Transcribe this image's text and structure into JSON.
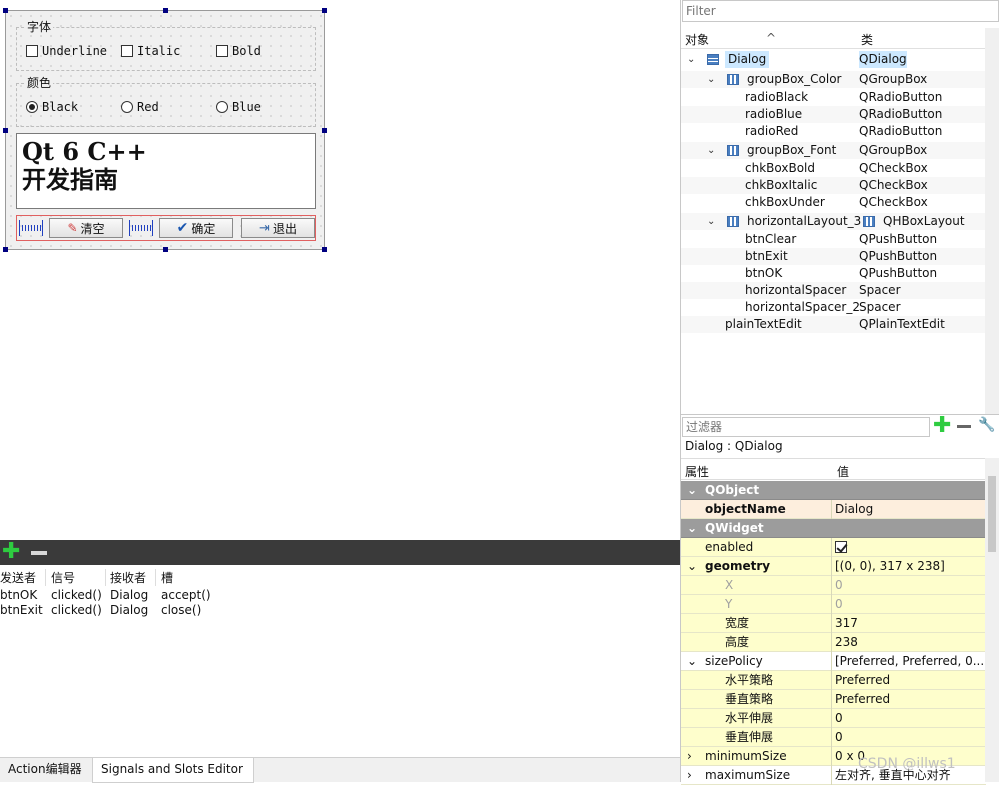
{
  "form": {
    "font_group_title": "字体",
    "checkboxes": [
      {
        "label": "Underline",
        "checked": false
      },
      {
        "label": "Italic",
        "checked": false
      },
      {
        "label": "Bold",
        "checked": false
      }
    ],
    "color_group_title": "颜色",
    "radios": [
      {
        "label": "Black",
        "checked": true
      },
      {
        "label": "Red",
        "checked": false
      },
      {
        "label": "Blue",
        "checked": false
      }
    ],
    "plain_text": "Qt 6 C++\n开发指南",
    "buttons": {
      "clear": "清空",
      "ok": "确定",
      "exit": "退出"
    }
  },
  "signals": {
    "headers": [
      "发送者",
      "信号",
      "接收者",
      "槽"
    ],
    "rows": [
      [
        "btnOK",
        "clicked()",
        "Dialog",
        "accept()"
      ],
      [
        "btnExit",
        "clicked()",
        "Dialog",
        "close()"
      ]
    ]
  },
  "bottom_tabs": [
    "Action编辑器",
    "Signals and Slots Editor"
  ],
  "object_inspector": {
    "filter_placeholder": "Filter",
    "col_object": "对象",
    "col_class": "类",
    "tree": [
      {
        "name": "Dialog",
        "class": "QDialog"
      },
      {
        "name": "groupBox_Color",
        "class": "QGroupBox"
      },
      {
        "name": "radioBlack",
        "class": "QRadioButton"
      },
      {
        "name": "radioBlue",
        "class": "QRadioButton"
      },
      {
        "name": "radioRed",
        "class": "QRadioButton"
      },
      {
        "name": "groupBox_Font",
        "class": "QGroupBox"
      },
      {
        "name": "chkBoxBold",
        "class": "QCheckBox"
      },
      {
        "name": "chkBoxItalic",
        "class": "QCheckBox"
      },
      {
        "name": "chkBoxUnder",
        "class": "QCheckBox"
      },
      {
        "name": "horizontalLayout_3",
        "class": "QHBoxLayout"
      },
      {
        "name": "btnClear",
        "class": "QPushButton"
      },
      {
        "name": "btnExit",
        "class": "QPushButton"
      },
      {
        "name": "btnOK",
        "class": "QPushButton"
      },
      {
        "name": "horizontalSpacer",
        "class": "Spacer"
      },
      {
        "name": "horizontalSpacer_2",
        "class": "Spacer"
      },
      {
        "name": "plainTextEdit",
        "class": "QPlainTextEdit"
      }
    ]
  },
  "property_editor": {
    "filter_placeholder": "过滤器",
    "title": "Dialog : QDialog",
    "col_property": "属性",
    "col_value": "值",
    "rows": [
      {
        "name": "QObject",
        "value": ""
      },
      {
        "name": "objectName",
        "value": "Dialog"
      },
      {
        "name": "QWidget",
        "value": ""
      },
      {
        "name": "enabled",
        "value": ""
      },
      {
        "name": "geometry",
        "value": "[(0, 0), 317 x 238]"
      },
      {
        "name": "X",
        "value": "0"
      },
      {
        "name": "Y",
        "value": "0"
      },
      {
        "name": "宽度",
        "value": "317"
      },
      {
        "name": "高度",
        "value": "238"
      },
      {
        "name": "sizePolicy",
        "value": "[Preferred, Preferred, 0..."
      },
      {
        "name": "水平策略",
        "value": "Preferred"
      },
      {
        "name": "垂直策略",
        "value": "Preferred"
      },
      {
        "name": "水平伸展",
        "value": "0"
      },
      {
        "name": "垂直伸展",
        "value": "0"
      },
      {
        "name": "minimumSize",
        "value": "0 x 0"
      },
      {
        "name": "maximumSize",
        "value": "左对齐, 垂直中心对齐"
      }
    ]
  },
  "watermark": "CSDN @illws1"
}
